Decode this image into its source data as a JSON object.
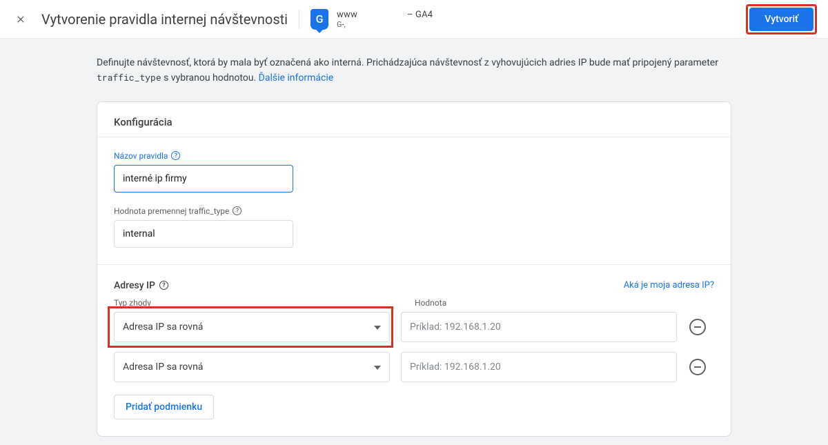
{
  "header": {
    "page_title": "Vytvorenie pravidla internej návštevnosti",
    "property_line1": "www                     – GA4",
    "property_line2": "G-,",
    "tag_letter": "G",
    "create_button": "Vytvoriť"
  },
  "intro": {
    "text_before_code": "Definujte návštevnosť, ktorá by mala byť označená ako interná. Prichádzajúca návštevnosť z vyhovujúcich adries IP bude mať pripojený parameter ",
    "code": "traffic_type",
    "text_after_code": " s vybranou hodnotou. ",
    "link": "Ďalšie informácie"
  },
  "card": {
    "title": "Konfigurácia",
    "rule_name_label": "Názov pravidla",
    "rule_name_value": "interné ip firmy",
    "traffic_type_label": "Hodnota premennej traffic_type",
    "traffic_type_value": "internal",
    "ip_section_title": "Adresy IP",
    "ip_help_link": "Aká je moja adresa IP?",
    "match_type_label": "Typ zhody",
    "value_label": "Hodnota",
    "conditions": [
      {
        "match": "Adresa IP sa rovná",
        "value": "",
        "placeholder": "Príklad: 192.168.1.20"
      },
      {
        "match": "Adresa IP sa rovná",
        "value": "",
        "placeholder": "Príklad: 192.168.1.20"
      }
    ],
    "add_condition": "Pridať podmienku"
  }
}
